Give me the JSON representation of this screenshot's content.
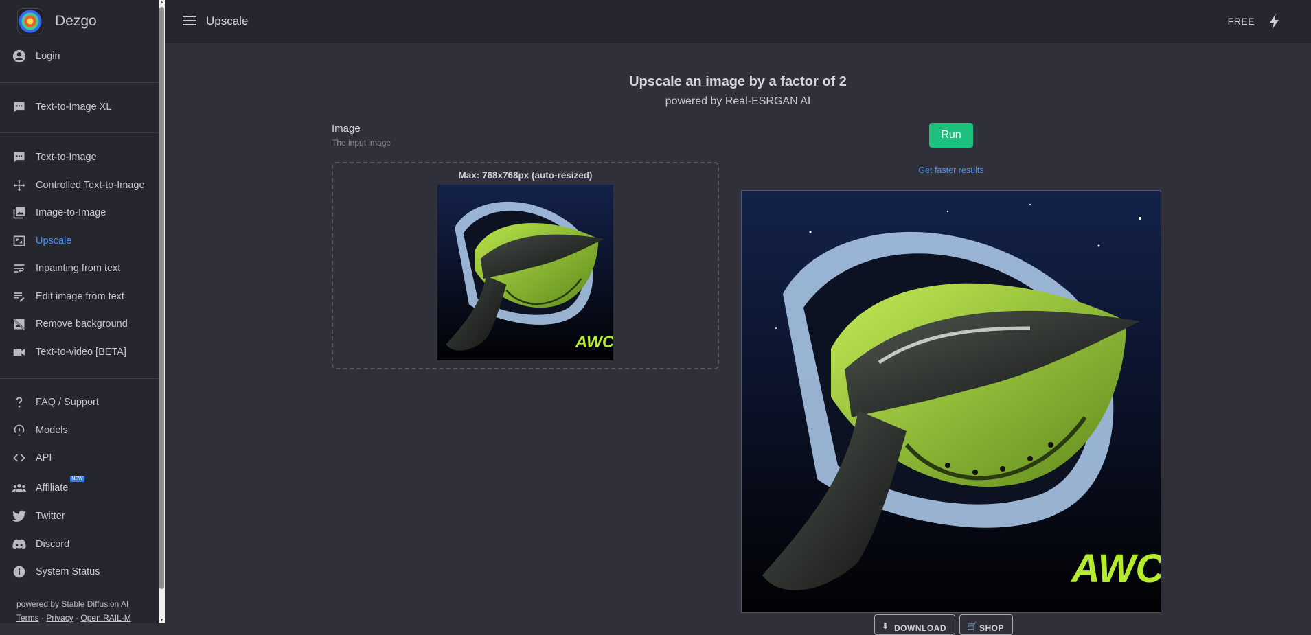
{
  "app": {
    "brand": "Dezgo"
  },
  "sidebar": {
    "login": "Login",
    "xl": "Text-to-Image XL",
    "items": [
      {
        "label": "Text-to-Image"
      },
      {
        "label": "Controlled Text-to-Image"
      },
      {
        "label": "Image-to-Image"
      },
      {
        "label": "Upscale"
      },
      {
        "label": "Inpainting from text"
      },
      {
        "label": "Edit image from text"
      },
      {
        "label": "Remove background"
      },
      {
        "label": "Text-to-video [BETA]"
      }
    ],
    "support": [
      {
        "label": "FAQ / Support"
      },
      {
        "label": "Models"
      },
      {
        "label": "API"
      },
      {
        "label": "Affiliate",
        "badge": "NEW"
      },
      {
        "label": "Twitter"
      },
      {
        "label": "Discord"
      },
      {
        "label": "System Status"
      }
    ],
    "footer": {
      "powered": "powered by Stable Diffusion AI",
      "terms": "Terms",
      "privacy": "Privacy",
      "license": "Open RAIL-M",
      "sep": "·"
    }
  },
  "header": {
    "title": "Upscale",
    "plan": "FREE"
  },
  "main": {
    "title": "Upscale an image by a factor of 2",
    "subtitle": "powered by Real-ESRGAN AI",
    "field_label": "Image",
    "field_help": "The input image",
    "dropzone_text": "Max: 768x768px (auto-resized)",
    "run_label": "Run",
    "faster_link": "Get faster results",
    "buttons": {
      "download": "DOWNLOAD",
      "shop": "SHOP"
    },
    "image_watermark": "AWCR"
  },
  "colors": {
    "accent": "#4a8ff5",
    "run": "#1cbf7c",
    "bg": "#30303a",
    "sidebar": "#26262e"
  }
}
